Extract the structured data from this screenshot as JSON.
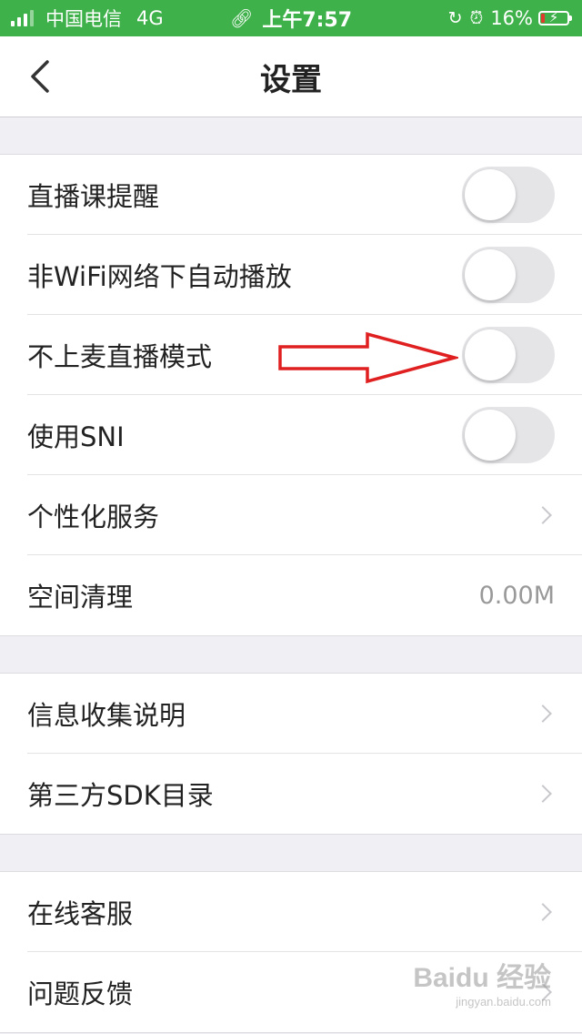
{
  "status_bar": {
    "carrier": "中国电信",
    "network": "4G",
    "link_icon": "link-icon",
    "time": "上午7:57",
    "lock_icon": "rotation-lock-icon",
    "alarm_icon": "alarm-icon",
    "battery_percent": "16%",
    "battery_level": 0.16,
    "bar_color": "#3fb14a",
    "battery_color": "#e03b2c"
  },
  "nav": {
    "back_icon": "chevron-left-icon",
    "title": "设置"
  },
  "sections": [
    {
      "rows": [
        {
          "label": "直播课提醒",
          "control": "toggle",
          "on": false
        },
        {
          "label": "非WiFi网络下自动播放",
          "control": "toggle",
          "on": false
        },
        {
          "label": "不上麦直播模式",
          "control": "toggle",
          "on": false
        },
        {
          "label": "使用SNI",
          "control": "toggle",
          "on": false
        },
        {
          "label": "个性化服务",
          "control": "chevron"
        },
        {
          "label": "空间清理",
          "control": "value",
          "value": "0.00M"
        }
      ]
    },
    {
      "rows": [
        {
          "label": "信息收集说明",
          "control": "chevron"
        },
        {
          "label": "第三方SDK目录",
          "control": "chevron"
        }
      ]
    },
    {
      "rows": [
        {
          "label": "在线客服",
          "control": "chevron"
        },
        {
          "label": "问题反馈",
          "control": "chevron"
        }
      ]
    }
  ],
  "annotation": {
    "arrow_color": "#e02020",
    "points_to": "不上麦直播模式 toggle"
  },
  "watermark": {
    "main": "Baidu 经验",
    "sub": "jingyan.baidu.com"
  }
}
